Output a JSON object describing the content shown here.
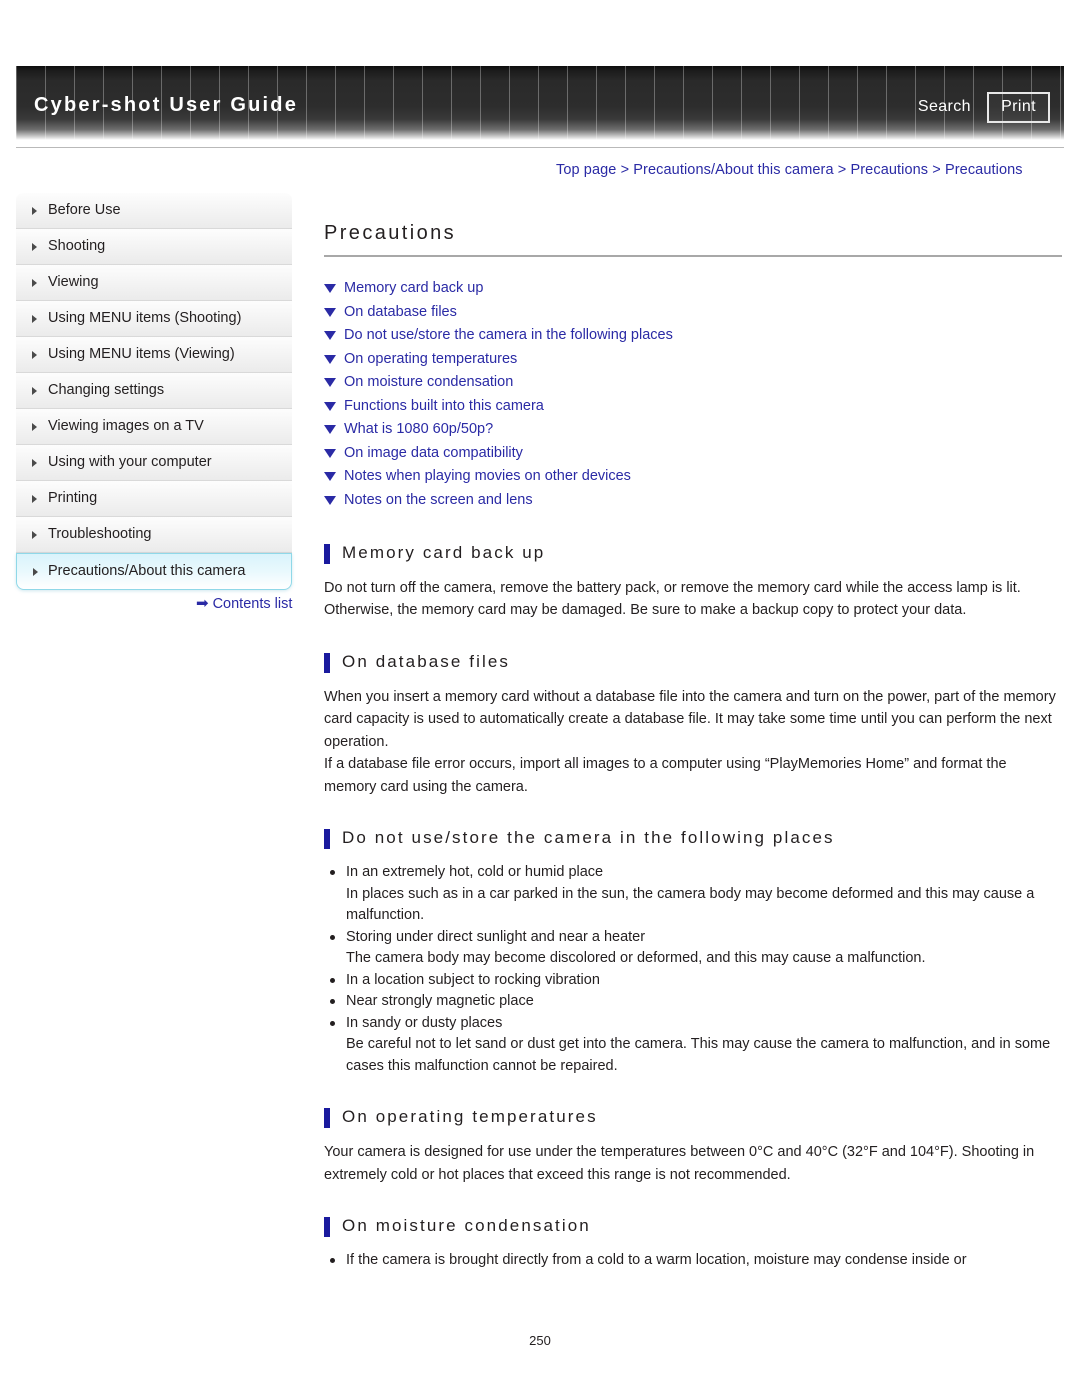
{
  "header": {
    "title": "Cyber-shot User Guide",
    "search_label": "Search",
    "print_label": "Print"
  },
  "breadcrumb": {
    "text": "Top page > Precautions/About this camera > Precautions > Precautions"
  },
  "sidebar": {
    "items": [
      {
        "label": "Before Use",
        "active": false
      },
      {
        "label": "Shooting",
        "active": false
      },
      {
        "label": "Viewing",
        "active": false
      },
      {
        "label": "Using MENU items (Shooting)",
        "active": false
      },
      {
        "label": "Using MENU items (Viewing)",
        "active": false
      },
      {
        "label": "Changing settings",
        "active": false
      },
      {
        "label": "Viewing images on a TV",
        "active": false
      },
      {
        "label": "Using with your computer",
        "active": false
      },
      {
        "label": "Printing",
        "active": false
      },
      {
        "label": "Troubleshooting",
        "active": false
      },
      {
        "label": "Precautions/About this camera",
        "active": true
      }
    ],
    "contents_list_label": "Contents list",
    "contents_list_arrow": "➡"
  },
  "main": {
    "page_title": "Precautions",
    "toc": [
      "Memory card back up",
      "On database files",
      "Do not use/store the camera in the following places",
      "On operating temperatures",
      "On moisture condensation",
      "Functions built into this camera",
      "What is 1080 60p/50p?",
      "On image data compatibility",
      "Notes when playing movies on other devices",
      "Notes on the screen and lens"
    ],
    "sections": {
      "memory_card_back_up": {
        "heading": "Memory card back up",
        "para": "Do not turn off the camera, remove the battery pack, or remove the memory card while the access lamp is lit. Otherwise, the memory card may be damaged. Be sure to make a backup copy to protect your data."
      },
      "on_database_files": {
        "heading": "On database files",
        "para1": "When you insert a memory card without a database file into the camera and turn on the power, part of the memory card capacity is used to automatically create a database file. It may take some time until you can perform the next operation.",
        "para2": "If a database file error occurs, import all images to a computer using “PlayMemories Home” and format the memory card using the camera."
      },
      "do_not_use_store": {
        "heading": "Do not use/store the camera in the following places",
        "items": [
          {
            "label": "In an extremely hot, cold or humid place",
            "detail": "In places such as in a car parked in the sun, the camera body may become deformed and this may cause a malfunction."
          },
          {
            "label": "Storing under direct sunlight and near a heater",
            "detail": "The camera body may become discolored or deformed, and this may cause a malfunction."
          },
          {
            "label": "In a location subject to rocking vibration",
            "detail": ""
          },
          {
            "label": "Near strongly magnetic place",
            "detail": ""
          },
          {
            "label": "In sandy or dusty places",
            "detail": "Be careful not to let sand or dust get into the camera. This may cause the camera to malfunction, and in some cases this malfunction cannot be repaired."
          }
        ]
      },
      "on_operating_temperatures": {
        "heading": "On operating temperatures",
        "para": "Your camera is designed for use under the temperatures between 0°C and 40°C (32°F and 104°F). Shooting in extremely cold or hot places that exceed this range is not recommended."
      },
      "on_moisture_condensation": {
        "heading": "On moisture condensation",
        "item1": "If the camera is brought directly from a cold to a warm location, moisture may condense inside or"
      }
    }
  },
  "footer": {
    "page_number": "250"
  }
}
